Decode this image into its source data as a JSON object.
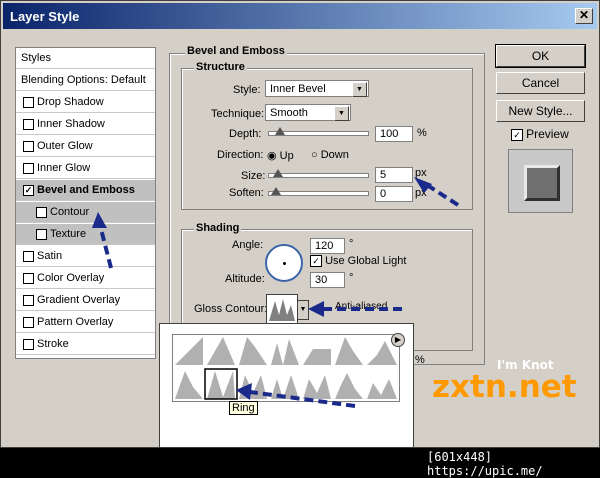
{
  "window": {
    "title": "Layer Style",
    "close_label": "✕"
  },
  "styles_panel": {
    "items": [
      {
        "label": "Styles",
        "type": "header",
        "checked": false
      },
      {
        "label": "Blending Options: Default",
        "type": "header",
        "checked": false
      },
      {
        "label": "Drop Shadow",
        "type": "item",
        "checked": false
      },
      {
        "label": "Inner Shadow",
        "type": "item",
        "checked": false
      },
      {
        "label": "Outer Glow",
        "type": "item",
        "checked": false
      },
      {
        "label": "Inner Glow",
        "type": "item",
        "checked": false
      },
      {
        "label": "Bevel and Emboss",
        "type": "item",
        "checked": true,
        "selected": true
      },
      {
        "label": "Contour",
        "type": "sub",
        "checked": false
      },
      {
        "label": "Texture",
        "type": "sub",
        "checked": false
      },
      {
        "label": "Satin",
        "type": "item",
        "checked": false
      },
      {
        "label": "Color Overlay",
        "type": "item",
        "checked": false
      },
      {
        "label": "Gradient Overlay",
        "type": "item",
        "checked": false
      },
      {
        "label": "Pattern Overlay",
        "type": "item",
        "checked": false
      },
      {
        "label": "Stroke",
        "type": "item",
        "checked": false
      }
    ]
  },
  "bevel": {
    "section_title": "Bevel and Emboss",
    "structure_title": "Structure",
    "style_label": "Style:",
    "style_value": "Inner Bevel",
    "technique_label": "Technique:",
    "technique_value": "Smooth",
    "depth_label": "Depth:",
    "depth_value": "100",
    "depth_unit": "%",
    "depth_level": 0.05,
    "direction_label": "Direction:",
    "direction_up": "Up",
    "direction_down": "Down",
    "size_label": "Size:",
    "size_value": "5",
    "size_unit": "px",
    "size_level": 0.02,
    "soften_label": "Soften:",
    "soften_value": "0",
    "soften_unit": "px",
    "soften_level": 0.0
  },
  "shading": {
    "title": "Shading",
    "angle_label": "Angle:",
    "angle_value": "120",
    "angle_unit": "°",
    "global_light_label": "Use Global Light",
    "altitude_label": "Altitude:",
    "altitude_value": "30",
    "altitude_unit": "°",
    "gloss_label": "Gloss Contour:",
    "antialiased_label": "Anti-aliased"
  },
  "buttons": {
    "ok": "OK",
    "cancel": "Cancel",
    "new_style": "New Style...",
    "preview": "Preview"
  },
  "contour_picker": {
    "tooltip": "Ring",
    "menu_icon": "right-arrow-circle-icon",
    "percent": "%"
  },
  "watermark": {
    "tagline": "I'm Knot",
    "brand": "zxtn.net"
  },
  "footer": {
    "text": "[601x448] https://upic.me/"
  },
  "colors": {
    "titlebar": "#0a246a",
    "dialog": "#d4d0c8",
    "watermark": "#ff9900",
    "arrow": "#1a2a8a"
  }
}
